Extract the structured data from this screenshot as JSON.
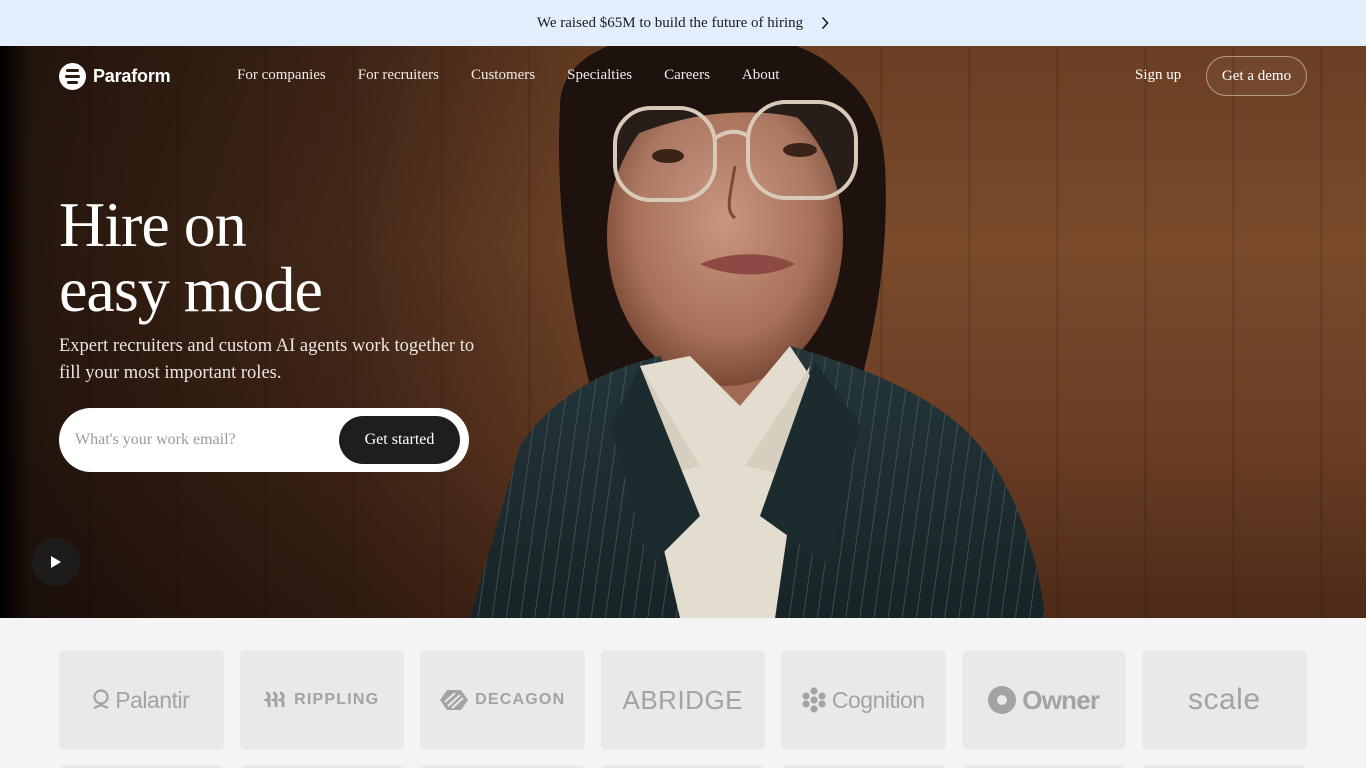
{
  "announcement": {
    "text": "We raised $65M to build the future of hiring"
  },
  "nav": {
    "brand": "Paraform",
    "links": [
      "For companies",
      "For recruiters",
      "Customers",
      "Specialties",
      "Careers",
      "About"
    ],
    "sign_up": "Sign up",
    "demo": "Get a demo"
  },
  "hero": {
    "headline_line1": "Hire on",
    "headline_line2": "easy mode",
    "subtitle": "Expert recruiters and custom AI agents work together to fill your most important roles.",
    "email_placeholder": "What's your work email?",
    "cta": "Get started"
  },
  "customers": [
    "Palantir",
    "RIPPLING",
    "DECAGON",
    "ABRIDGE",
    "Cognition",
    "Owner",
    "scale"
  ]
}
